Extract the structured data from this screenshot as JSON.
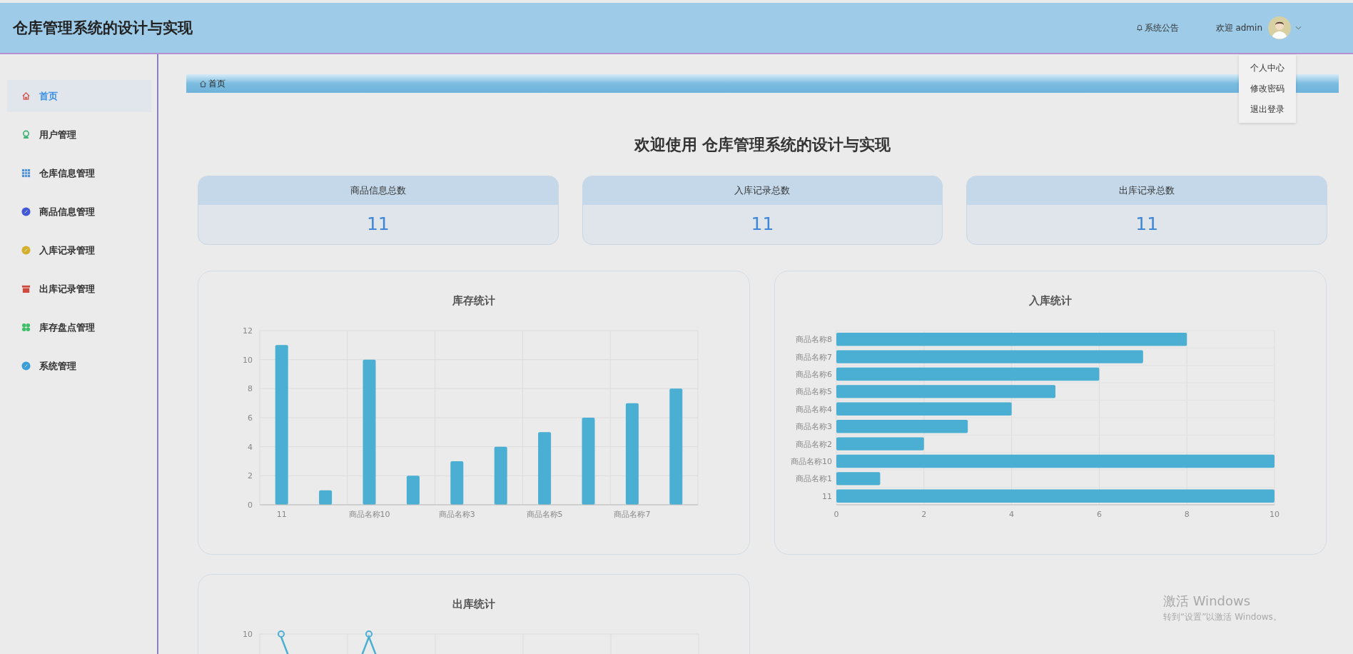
{
  "header": {
    "title": "仓库管理系统的设计与实现",
    "notice": "系统公告",
    "welcome": "欢迎 admin"
  },
  "user_menu": {
    "items": [
      "个人中心",
      "修改密码",
      "退出登录"
    ]
  },
  "sidebar": {
    "items": [
      {
        "label": "首页",
        "selected": true,
        "color": "#d9534f"
      },
      {
        "label": "用户管理",
        "selected": false,
        "color": "#3cb371"
      },
      {
        "label": "仓库信息管理",
        "selected": false,
        "color": "#4a90d9"
      },
      {
        "label": "商品信息管理",
        "selected": false,
        "color": "#4159d9"
      },
      {
        "label": "入库记录管理",
        "selected": false,
        "color": "#d4b02c"
      },
      {
        "label": "出库记录管理",
        "selected": false,
        "color": "#d0493d"
      },
      {
        "label": "库存盘点管理",
        "selected": false,
        "color": "#3fbf6a"
      },
      {
        "label": "系统管理",
        "selected": false,
        "color": "#3a9fd9"
      }
    ]
  },
  "breadcrumb": {
    "label": "首页"
  },
  "welcome": "欢迎使用 仓库管理系统的设计与实现",
  "stats": [
    {
      "label": "商品信息总数",
      "value": "11"
    },
    {
      "label": "入库记录总数",
      "value": "11"
    },
    {
      "label": "出库记录总数",
      "value": "11"
    }
  ],
  "charts": [
    {
      "chart_data": {
        "type": "bar",
        "title": "库存统计",
        "orientation": "vertical",
        "grid": true,
        "ylim": [
          0,
          12
        ],
        "yticks": [
          0,
          2,
          4,
          6,
          8,
          10,
          12
        ],
        "categories": [
          "11",
          null,
          "商品名称10",
          null,
          "商品名称3",
          null,
          "商品名称5",
          null,
          "商品名称7",
          null
        ],
        "series": [
          {
            "color": "#4aafd2",
            "values": [
              11,
              1,
              10,
              2,
              3,
              4,
              5,
              6,
              7,
              8
            ]
          }
        ]
      }
    },
    {
      "chart_data": {
        "type": "bar",
        "title": "入库统计",
        "orientation": "horizontal",
        "grid": true,
        "xlim": [
          0,
          10
        ],
        "xticks": [
          0,
          2,
          4,
          6,
          8,
          10
        ],
        "categories": [
          "商品名称8",
          "商品名称7",
          "商品名称6",
          "商品名称5",
          "商品名称4",
          "商品名称3",
          "商品名称2",
          "商品名称10",
          "商品名称1",
          "11"
        ],
        "series": [
          {
            "color": "#4aafd2",
            "values": [
              8,
              7,
              6,
              5,
              4,
              3,
              2,
              10,
              1,
              10
            ]
          }
        ]
      }
    },
    {
      "title": "出库统计",
      "axis_label": "10"
    }
  ],
  "windows_notice": {
    "title": "激活 Windows",
    "hint": "转到“设置”以激活 Windows。"
  }
}
